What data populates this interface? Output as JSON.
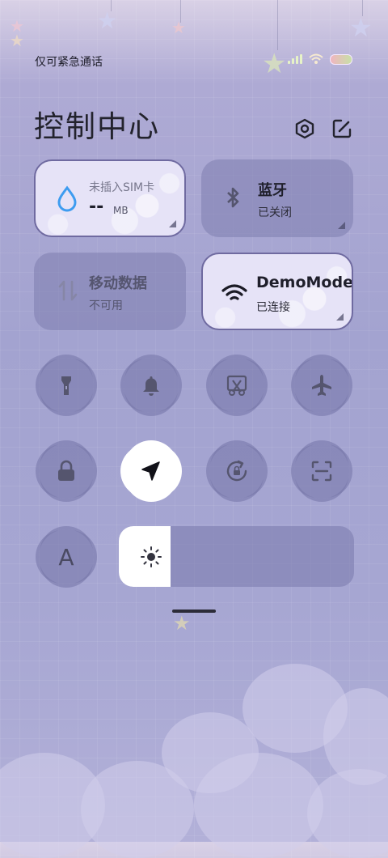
{
  "status_bar": {
    "carrier_text": "仅可紧急通话",
    "icons": [
      "signal-icon",
      "wifi-icon",
      "battery-icon"
    ]
  },
  "header": {
    "title": "控制中心",
    "icons": [
      "settings-icon",
      "edit-icon"
    ]
  },
  "tiles": {
    "data_usage": {
      "top": "未插入SIM卡",
      "value": "--",
      "unit": "MB",
      "icon": "water-drop-icon",
      "active": true
    },
    "bluetooth": {
      "label": "蓝牙",
      "status": "已关闭",
      "icon": "bluetooth-icon",
      "active": false
    },
    "mobile_data": {
      "label": "移动数据",
      "status": "不可用",
      "icon": "mobile-data-icon",
      "active": false
    },
    "wifi": {
      "label": "DemoMode",
      "status": "已连接",
      "icon": "wifi-icon",
      "active": true
    }
  },
  "toggles_row1": [
    {
      "name": "flashlight",
      "icon": "flashlight-icon",
      "active": false
    },
    {
      "name": "ring",
      "icon": "bell-icon",
      "active": false
    },
    {
      "name": "screenshot",
      "icon": "screenshot-scissors-icon",
      "active": false
    },
    {
      "name": "airplane",
      "icon": "airplane-icon",
      "active": false
    }
  ],
  "toggles_row2": [
    {
      "name": "lock-screen",
      "icon": "lock-icon",
      "active": false
    },
    {
      "name": "location",
      "icon": "location-arrow-icon",
      "active": true
    },
    {
      "name": "auto-rotate",
      "icon": "rotate-lock-icon",
      "active": false
    },
    {
      "name": "scanner",
      "icon": "scan-icon",
      "active": false
    }
  ],
  "auto_brightness": {
    "label": "A",
    "icon": "auto-brightness-icon"
  },
  "brightness": {
    "level": 0.22,
    "icon": "sun-icon"
  },
  "colors": {
    "tile_off": "#7d7daf",
    "tile_on_border": "#6f6aa0",
    "accent_blue": "#3d9cf0",
    "text_dark": "#1f1f2b"
  }
}
